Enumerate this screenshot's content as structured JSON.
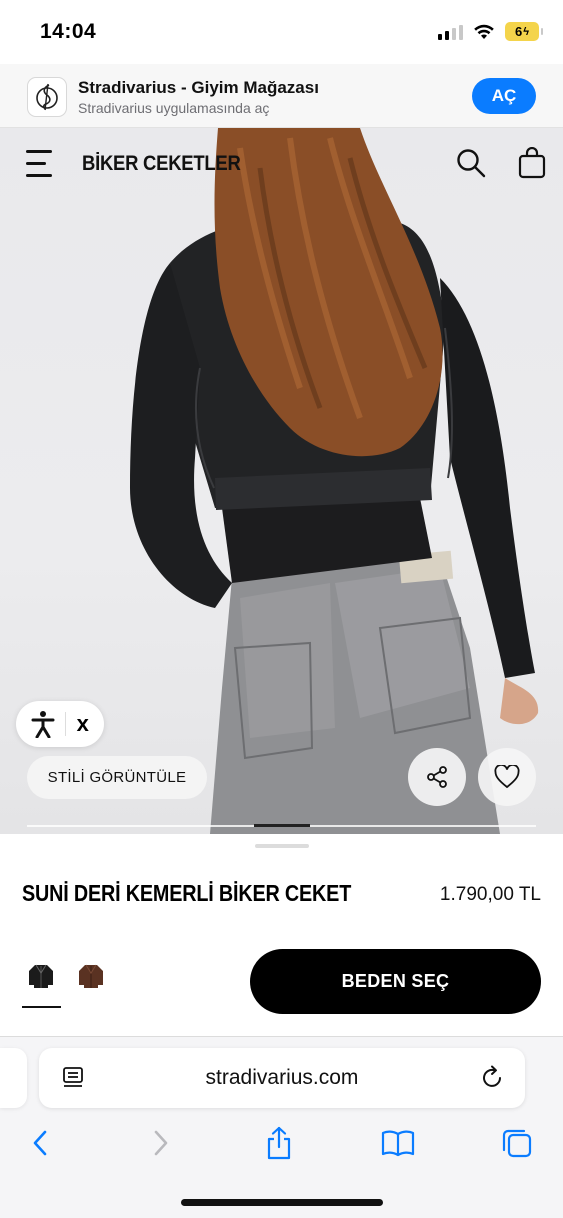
{
  "status_bar": {
    "time": "14:04",
    "battery": "6"
  },
  "app_banner": {
    "name": "Stradivarius - Giyim Mağazası",
    "subtitle": "Stradivarius uygulamasında aç",
    "open_label": "AÇ"
  },
  "header": {
    "title": "BİKER CEKETLER"
  },
  "hero": {
    "accessibility_close": "x",
    "style_button": "STİLİ GÖRÜNTÜLE",
    "image_progress": 0.11
  },
  "product": {
    "name": "SUNİ DERİ KEMERLİ BİKER CEKET",
    "price": "1.790,00 TL",
    "colors": [
      "black-jacket",
      "brown-jacket"
    ],
    "selected_color_index": 0,
    "size_button": "BEDEN SEÇ"
  },
  "browser": {
    "url": "stradivarius.com"
  }
}
